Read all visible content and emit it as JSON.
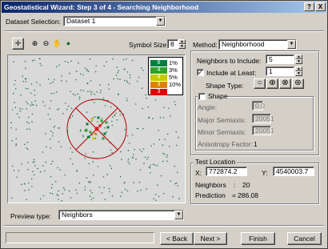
{
  "window": {
    "title": "Geostatistical Wizard: Step 3 of 4 - Searching Neighborhood",
    "help_label": "?",
    "close_label": "X"
  },
  "dataset": {
    "label": "Dataset Selection:",
    "value": "Dataset 1"
  },
  "toolbar": {
    "icons": [
      "select-icon",
      "zoom-in-icon",
      "zoom-out-icon",
      "pan-hand-icon",
      "globe-icon"
    ]
  },
  "symbol_size": {
    "label": "Symbol Size:",
    "value": "8"
  },
  "legend": {
    "rows": [
      {
        "count": "6",
        "label": "1%",
        "color": "#007f3f"
      },
      {
        "count": "4",
        "label": "3%",
        "color": "#2ea02e"
      },
      {
        "count": "4",
        "label": "5%",
        "color": "#c8c800"
      },
      {
        "count": "3",
        "label": "10%",
        "color": "#e08000"
      },
      {
        "count": "3",
        "label": "",
        "color": "#e00000"
      }
    ]
  },
  "method": {
    "label": "Method:",
    "value": "Neighborhood"
  },
  "neighbors_include": {
    "label": "Neighbors to Include:",
    "value": "5"
  },
  "include_at_least": {
    "label": "Include at Least:",
    "value": "1",
    "checked": true
  },
  "shape_type": {
    "label": "Shape Type:",
    "icons": [
      "circle-shape-icon",
      "circle-quad-shape-icon",
      "circle-x-shape-icon",
      "circle-8sector-shape-icon"
    ]
  },
  "shape": {
    "label": "Shape",
    "checked": false,
    "angle_label": "Angle:",
    "angle_value": "0.0",
    "major_label": "Major Semiaxis:",
    "major_value": "20051",
    "minor_label": "Minor Semiaxis:",
    "minor_value": "20051",
    "anisotropy_label": "Anisotropy Factor:",
    "anisotropy_value": "1"
  },
  "test_location": {
    "label": "Test Location",
    "x_label": "X:",
    "x_value": "772874.2",
    "y_label": "Y:",
    "y_value": "4540003.7",
    "neighbors_label": "Neighbors",
    "neighbors_sep": ":",
    "neighbors_value": "20",
    "prediction_label": "Prediction",
    "prediction_sep": "=",
    "prediction_value": "286.08"
  },
  "preview": {
    "label": "Preview type:",
    "value": "Neighbors"
  },
  "buttons": {
    "back": "< Back",
    "next": "Next >",
    "finish": "Finish",
    "cancel": "Cancel"
  }
}
